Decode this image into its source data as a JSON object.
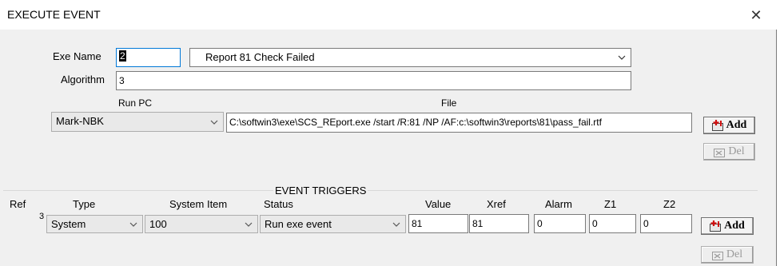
{
  "window": {
    "title": "EXECUTE EVENT",
    "close_glyph": "✕"
  },
  "form": {
    "exe_name_label": "Exe Name",
    "exe_name_value": "2",
    "description_value": "Report 81 Check Failed",
    "algorithm_label": "Algorithm",
    "algorithm_value": "3",
    "run_pc_label": "Run PC",
    "run_pc_value": "Mark-NBK",
    "file_label": "File",
    "file_value": "C:\\softwin3\\exe\\SCS_REport.exe /start /R:81 /NP /AF:c:\\softwin3\\reports\\81\\pass_fail.rtf",
    "add_label": "Add",
    "del_label": "Del"
  },
  "triggers": {
    "section_title": "EVENT TRIGGERS",
    "columns": {
      "ref": "Ref",
      "type": "Type",
      "system_item": "System Item",
      "status": "Status",
      "value": "Value",
      "xref": "Xref",
      "alarm": "Alarm",
      "z1": "Z1",
      "z2": "Z2"
    },
    "rows": [
      {
        "ref": "3",
        "type": "System",
        "system_item": "100",
        "status": "Run exe event",
        "value": "81",
        "xref": "81",
        "alarm": "0",
        "z1": "0",
        "z2": "0"
      }
    ],
    "add_label": "Add",
    "del_label": "Del"
  },
  "icons": {
    "add": "add-record-icon",
    "del": "delete-record-icon",
    "dropdown": "chevron-down-icon",
    "close": "close-icon"
  }
}
